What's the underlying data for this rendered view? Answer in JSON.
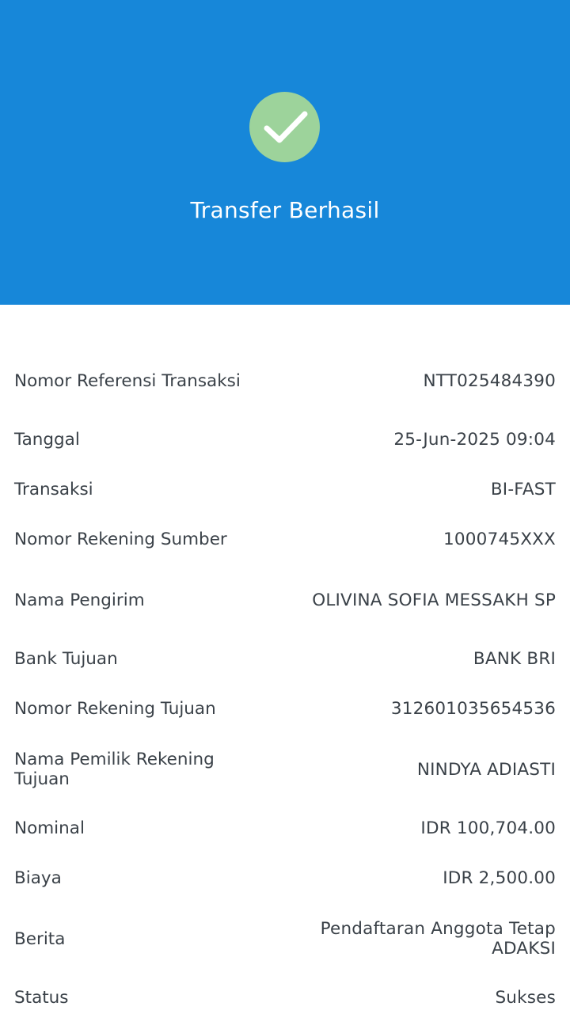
{
  "header": {
    "title": "Transfer Berhasil",
    "icon": "check-circle-icon",
    "background_color": "#1787d9",
    "icon_color": "#9dd39b"
  },
  "details": [
    {
      "label": "Nomor Referensi Transaksi",
      "value": "NTT025484390"
    },
    {
      "label": "Tanggal",
      "value": "25-Jun-2025 09:04"
    },
    {
      "label": "Transaksi",
      "value": "BI-FAST"
    },
    {
      "label": "Nomor Rekening Sumber",
      "value": "1000745XXX"
    },
    {
      "label": "Nama Pengirim",
      "value": "OLIVINA SOFIA MESSAKH SP"
    },
    {
      "label": "Bank Tujuan",
      "value": "BANK BRI"
    },
    {
      "label": "Nomor Rekening Tujuan",
      "value": "312601035654536"
    },
    {
      "label": "Nama Pemilik Rekening Tujuan",
      "value": "NINDYA ADIASTI"
    },
    {
      "label": "Nominal",
      "value": "IDR 100,704.00"
    },
    {
      "label": "Biaya",
      "value": "IDR 2,500.00"
    },
    {
      "label": "Berita",
      "value": "Pendaftaran Anggota Tetap ADAKSI"
    },
    {
      "label": "Status",
      "value": "Sukses"
    }
  ]
}
